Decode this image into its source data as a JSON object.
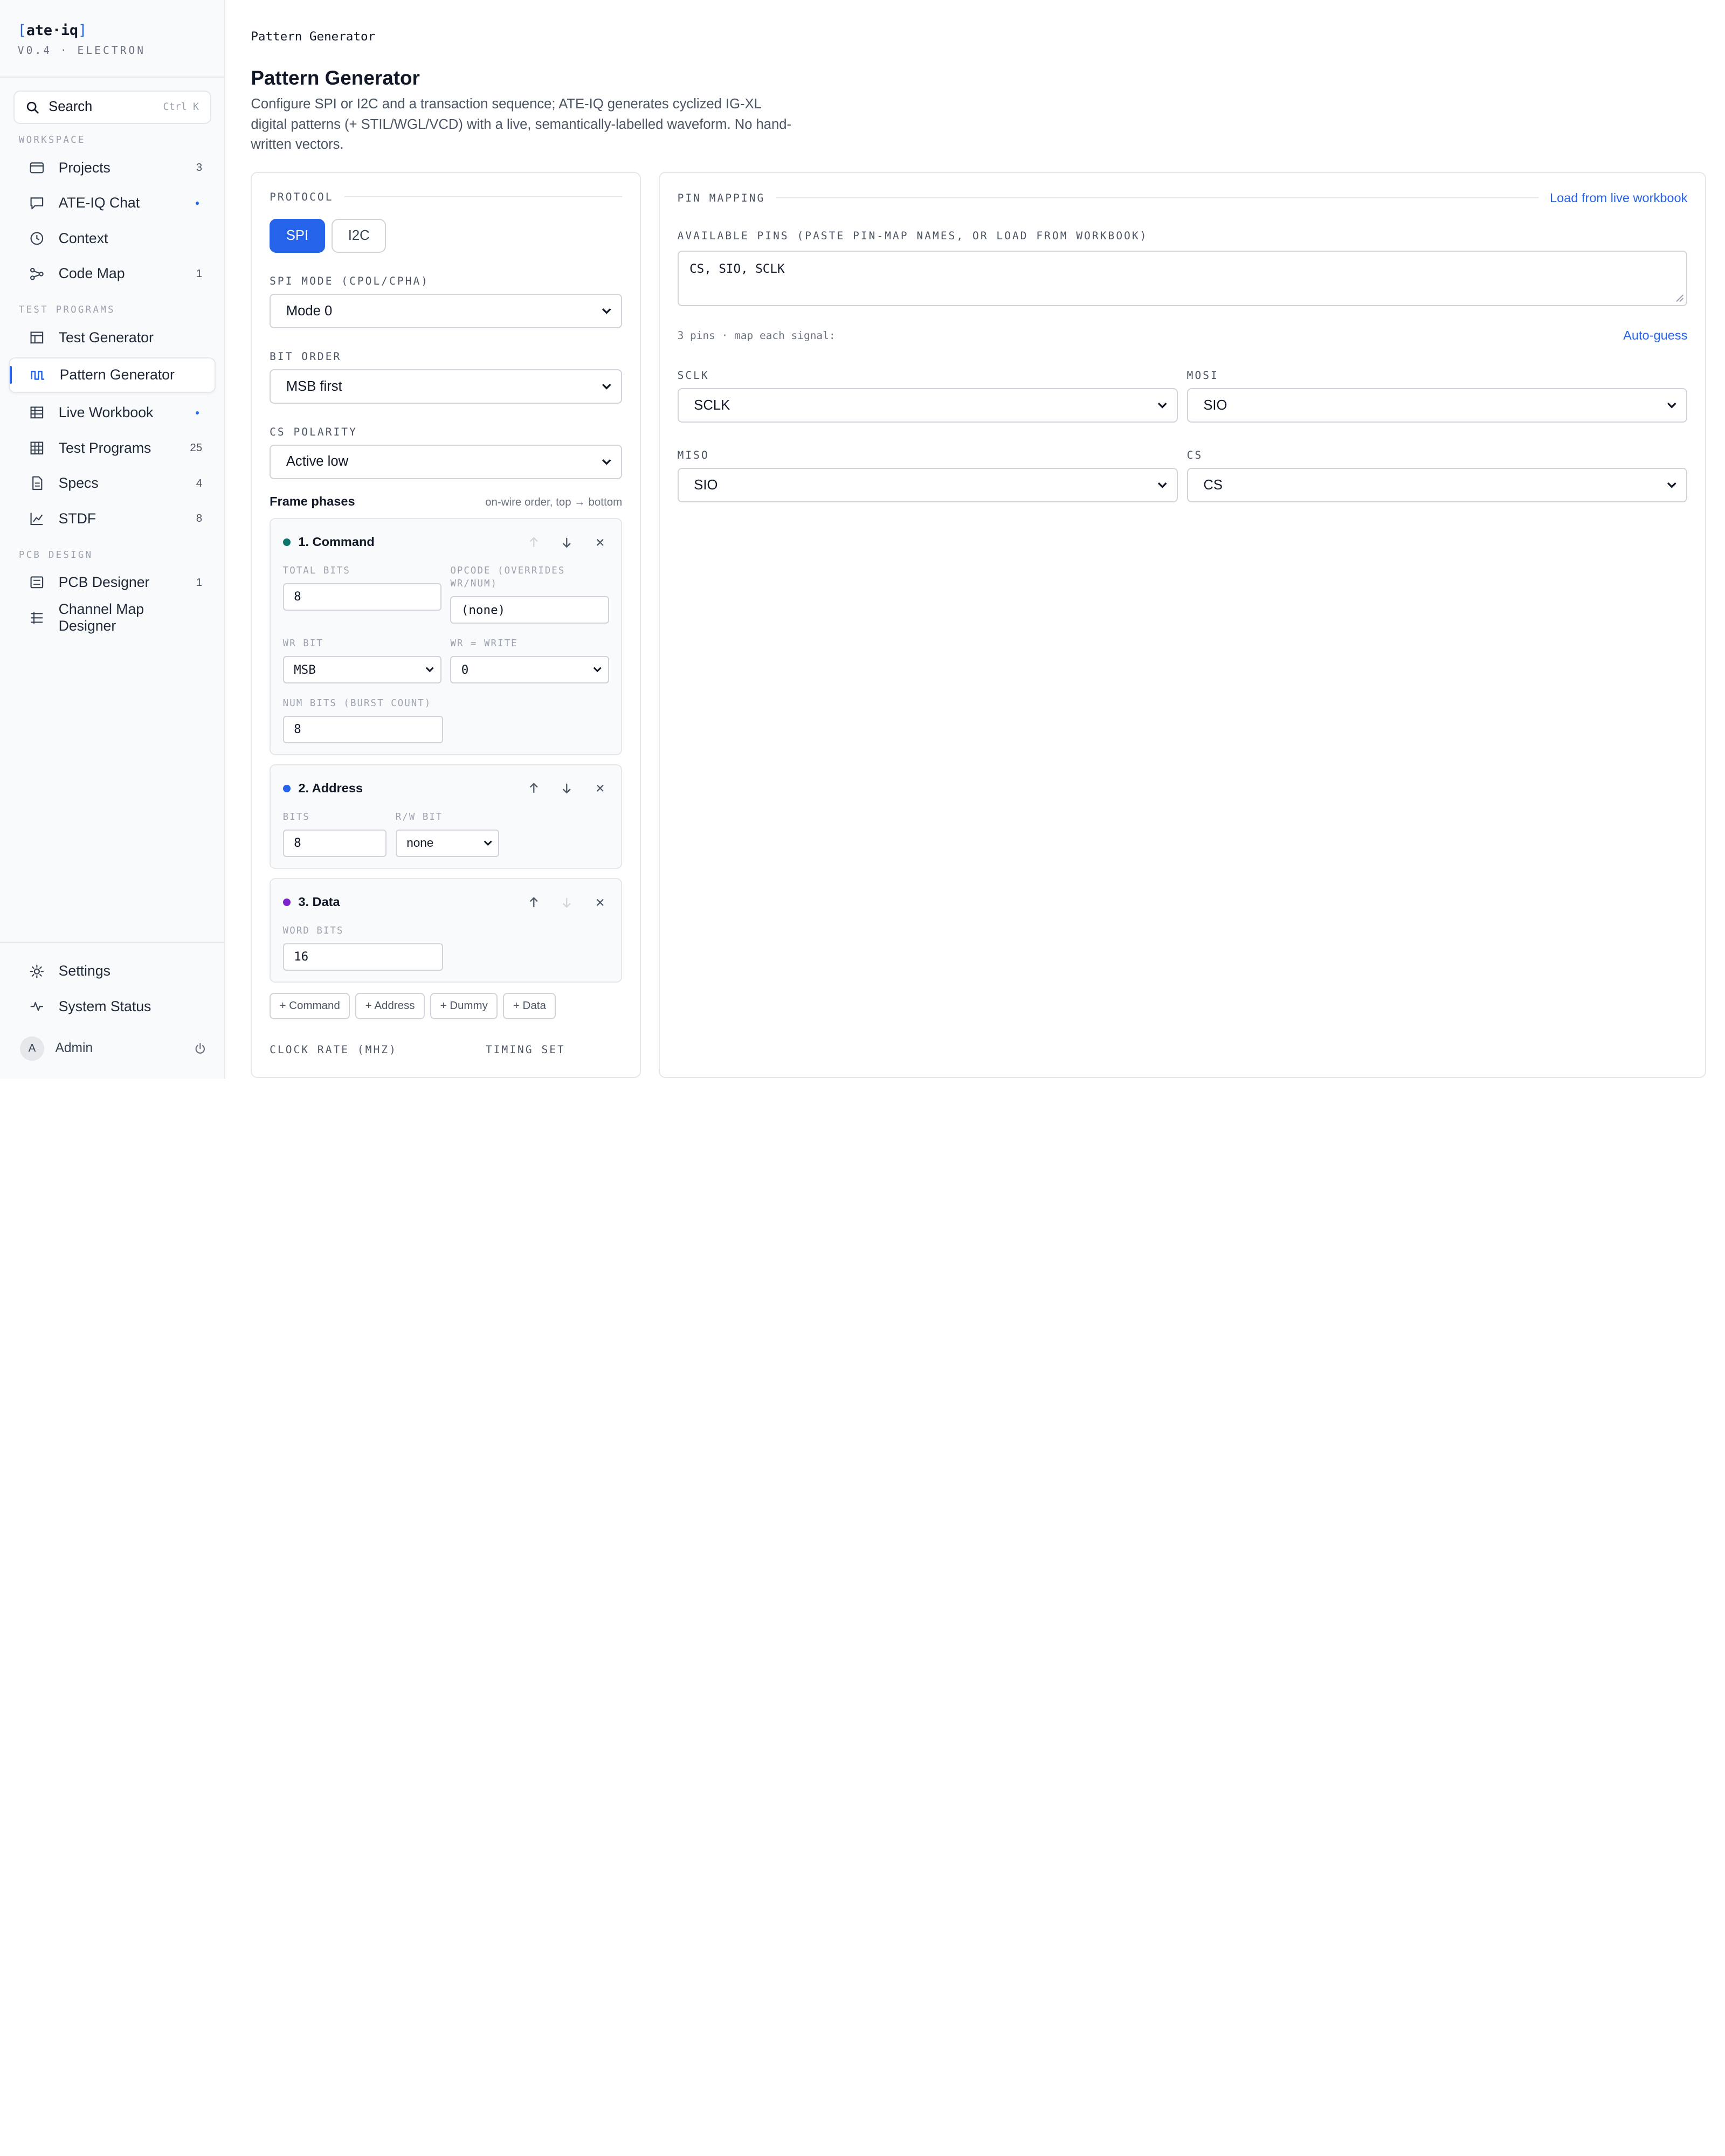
{
  "brand": {
    "name": "ate·iq",
    "bracket_open": "[",
    "bracket_close": "]",
    "version": "V0.4 · ELECTRON"
  },
  "search": {
    "label": "Search",
    "shortcut": "Ctrl K"
  },
  "sidebar": {
    "workspace_label": "WORKSPACE",
    "workspace": [
      {
        "label": "Projects",
        "count": "3",
        "icon": "folder-icon"
      },
      {
        "label": "ATE-IQ Chat",
        "count": "",
        "icon": "chat-icon",
        "dot": true
      },
      {
        "label": "Context",
        "count": "",
        "icon": "clock-icon"
      },
      {
        "label": "Code Map",
        "count": "1",
        "icon": "graph-icon"
      }
    ],
    "test_label": "TEST PROGRAMS",
    "test": [
      {
        "label": "Test Generator",
        "count": "",
        "icon": "table-icon"
      },
      {
        "label": "Pattern Generator",
        "count": "",
        "icon": "waveform-icon",
        "active": true
      },
      {
        "label": "Live Workbook",
        "count": "",
        "icon": "workbook-icon",
        "dot": true
      },
      {
        "label": "Test Programs",
        "count": "25",
        "icon": "grid-icon"
      },
      {
        "label": "Specs",
        "count": "4",
        "icon": "document-icon"
      },
      {
        "label": "STDF",
        "count": "8",
        "icon": "chart-icon"
      }
    ],
    "pcb_label": "PCB DESIGN",
    "pcb": [
      {
        "label": "PCB Designer",
        "count": "1",
        "icon": "board-icon"
      },
      {
        "label": "Channel Map Designer",
        "count": "",
        "icon": "list-icon"
      }
    ],
    "settings": "Settings",
    "status": "System Status",
    "user": {
      "initial": "A",
      "name": "Admin"
    }
  },
  "page": {
    "breadcrumb": "Pattern Generator",
    "title": "Pattern Generator",
    "description": "Configure SPI or I2C and a transaction sequence; ATE-IQ generates cyclized IG-XL digital patterns (+ STIL/WGL/VCD) with a live, semantically-labelled waveform. No hand-written vectors."
  },
  "protocol": {
    "label": "PROTOCOL",
    "options": [
      "SPI",
      "I2C"
    ],
    "selected": "SPI",
    "spi_mode_label": "SPI MODE (CPOL/CPHA)",
    "spi_mode": "Mode 0",
    "bit_order_label": "BIT ORDER",
    "bit_order": "MSB first",
    "cs_polarity_label": "CS POLARITY",
    "cs_polarity": "Active low",
    "phases_title": "Frame phases",
    "phases_hint": "on-wire order, top → bottom",
    "phases": {
      "command": {
        "title": "1. Command",
        "color": "#0f766e",
        "total_bits_label": "TOTAL BITS",
        "total_bits": "8",
        "opcode_label": "OPCODE (OVERRIDES WR/NUM)",
        "opcode": "(none)",
        "wr_bit_label": "WR BIT",
        "wr_bit": "MSB",
        "wr_write_label": "WR = WRITE",
        "wr_write": "0",
        "num_bits_label": "NUM BITS (BURST COUNT)",
        "num_bits": "8"
      },
      "address": {
        "title": "2. Address",
        "color": "#2563eb",
        "bits_label": "BITS",
        "bits": "8",
        "rw_label": "R/W BIT",
        "rw": "none"
      },
      "data": {
        "title": "3. Data",
        "color": "#7e22ce",
        "word_bits_label": "WORD BITS",
        "word_bits": "16"
      }
    },
    "add_buttons": [
      "+ Command",
      "+ Address",
      "+ Dummy",
      "+ Data"
    ],
    "clock_rate_label": "CLOCK RATE (MHZ)",
    "timing_set_label": "TIMING SET"
  },
  "pin_mapping": {
    "label": "PIN MAPPING",
    "load_link": "Load from live workbook",
    "available_label": "AVAILABLE PINS (PASTE PIN-MAP NAMES, OR LOAD FROM WORKBOOK)",
    "available_value": "CS, SIO, SCLK",
    "meta": "3 pins · map each signal:",
    "auto_guess": "Auto-guess",
    "signals": [
      {
        "label": "SCLK",
        "value": "SCLK"
      },
      {
        "label": "MOSI",
        "value": "SIO"
      },
      {
        "label": "MISO",
        "value": "SIO"
      },
      {
        "label": "CS",
        "value": "CS"
      }
    ]
  },
  "colors": {
    "accent": "#2563eb",
    "border": "#e5e7eb"
  }
}
